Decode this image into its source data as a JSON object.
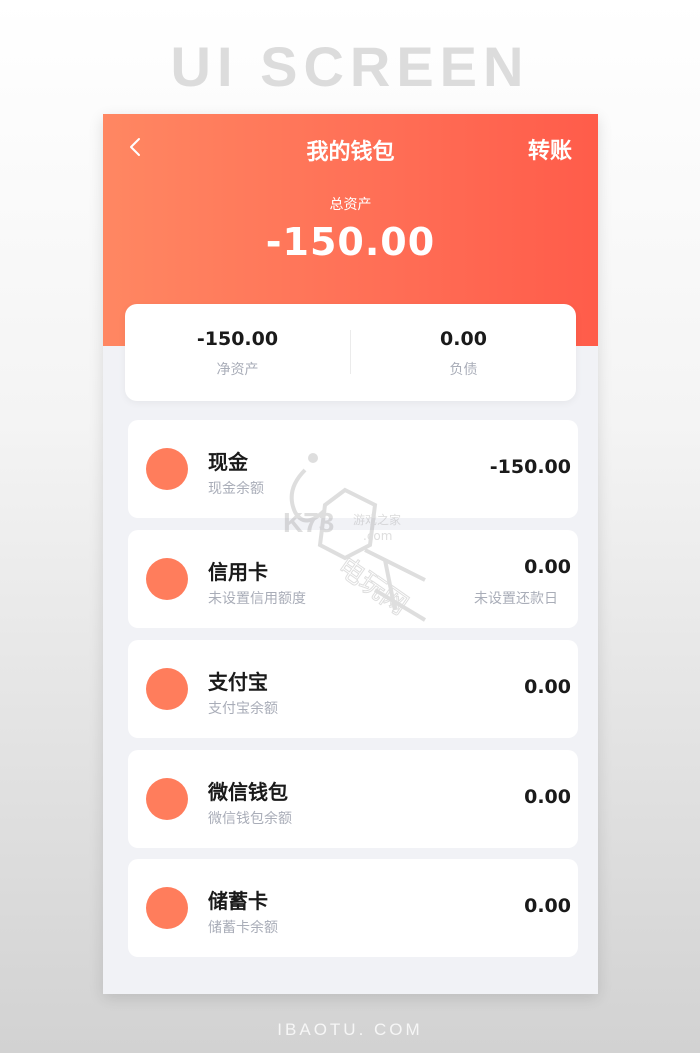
{
  "mockup_title": "UI SCREEN",
  "footer": "IBAOTU. COM",
  "colors": {
    "header_start": "#ff8762",
    "header_end": "#ff5c4a",
    "account_dot": "#ff7d5c",
    "background": "#f1f2f6"
  },
  "header": {
    "title": "我的钱包",
    "back_icon": "chevron-left-icon",
    "transfer_label": "转账",
    "total_assets_label": "总资产",
    "total_assets_value": "-150.00"
  },
  "summary": {
    "net_assets_value": "-150.00",
    "net_assets_label": "净资产",
    "liabilities_value": "0.00",
    "liabilities_label": "负债"
  },
  "accounts": [
    {
      "name": "现金",
      "sub": "现金余额",
      "amount": "-150.00",
      "note": ""
    },
    {
      "name": "信用卡",
      "sub": "未设置信用额度",
      "amount": "0.00",
      "note": "未设置还款日"
    },
    {
      "name": "支付宝",
      "sub": "支付宝余额",
      "amount": "0.00",
      "note": ""
    },
    {
      "name": "微信钱包",
      "sub": "微信钱包余额",
      "amount": "0.00",
      "note": ""
    },
    {
      "name": "储蓄卡",
      "sub": "储蓄卡余额",
      "amount": "0.00",
      "note": ""
    }
  ],
  "watermark": {
    "brand": "K73",
    "tagline": "游戏之家",
    "domain": ".com",
    "site": "电玩网"
  }
}
